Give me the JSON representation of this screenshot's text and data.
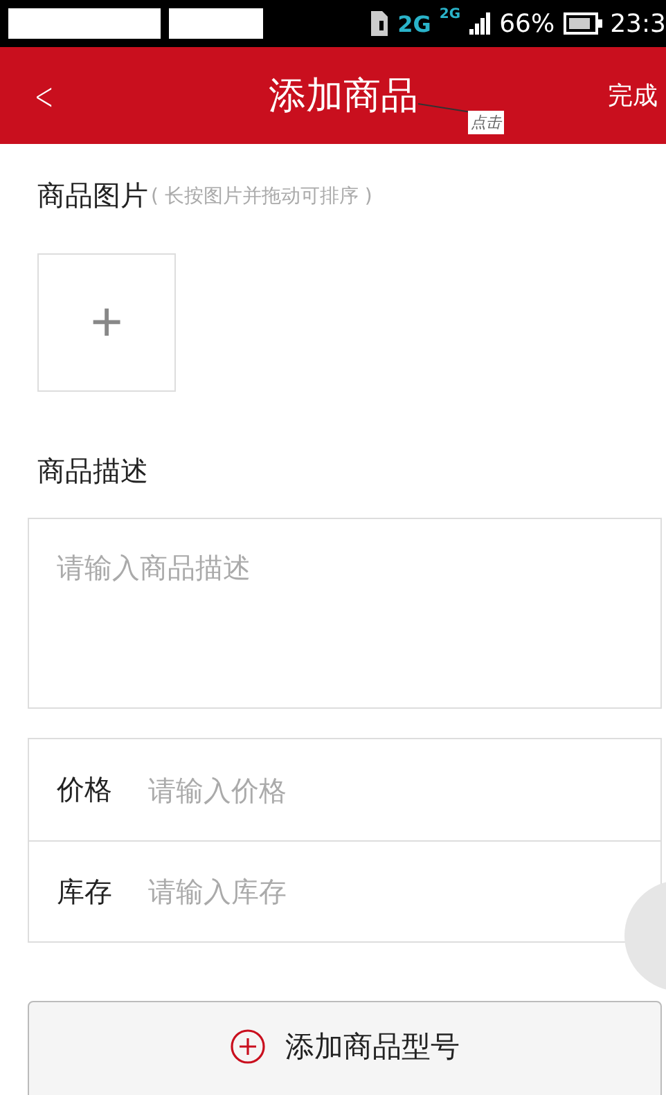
{
  "status_bar": {
    "network_1": "2G",
    "network_2": "2G",
    "battery": "66%",
    "time": "23:3"
  },
  "nav_bar": {
    "back": "<",
    "title": "添加商品",
    "action": "完成"
  },
  "annotation": {
    "text": "点击"
  },
  "images_section": {
    "label": "商品图片",
    "hint": "( 长按图片并拖动可排序 )",
    "add_symbol": "+"
  },
  "description_section": {
    "label": "商品描述",
    "placeholder": "请输入商品描述"
  },
  "fields": [
    {
      "label": "价格",
      "placeholder": "请输入价格"
    },
    {
      "label": "库存",
      "placeholder": "请输入库存"
    }
  ],
  "add_variant_button": {
    "label": "添加商品型号"
  }
}
